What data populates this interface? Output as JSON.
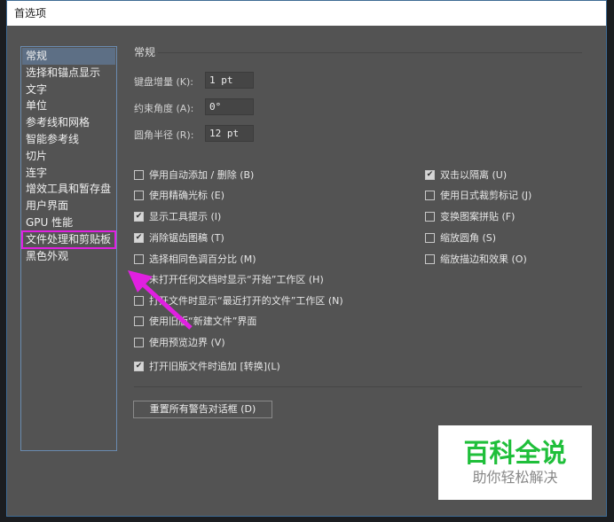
{
  "window": {
    "title": "首选项"
  },
  "sidebar": {
    "items": [
      "常规",
      "选择和锚点显示",
      "文字",
      "单位",
      "参考线和网格",
      "智能参考线",
      "切片",
      "连字",
      "增效工具和暂存盘",
      "用户界面",
      "GPU 性能",
      "文件处理和剪贴板",
      "黑色外观"
    ]
  },
  "main": {
    "heading": "常规",
    "fields": [
      {
        "label": "键盘增量 (K):",
        "value": "1 pt"
      },
      {
        "label": "约束角度 (A):",
        "value": "0°"
      },
      {
        "label": "圆角半径 (R):",
        "value": "12 pt"
      }
    ],
    "left_checks": [
      {
        "label": "停用自动添加 / 删除 (B)",
        "checked": false
      },
      {
        "label": "使用精确光标 (E)",
        "checked": false
      },
      {
        "label": "显示工具提示 (I)",
        "checked": true
      },
      {
        "label": "消除锯齿图稿 (T)",
        "checked": true
      },
      {
        "label": "选择相同色调百分比 (M)",
        "checked": false
      },
      {
        "label": "未打开任何文档时显示“开始”工作区 (H)",
        "checked": true
      },
      {
        "label": "打开文件时显示“最近打开的文件”工作区 (N)",
        "checked": false
      },
      {
        "label": "使用旧版“新建文件”界面",
        "checked": false
      },
      {
        "label": "使用预览边界 (V)",
        "checked": false
      },
      {
        "label": "打开旧版文件时追加 [转换](L)",
        "checked": true
      }
    ],
    "right_checks": [
      {
        "label": "双击以隔离 (U)",
        "checked": true
      },
      {
        "label": "使用日式裁剪标记 (J)",
        "checked": false
      },
      {
        "label": "变换图案拼贴 (F)",
        "checked": false
      },
      {
        "label": "缩放圆角 (S)",
        "checked": false
      },
      {
        "label": "缩放描边和效果 (O)",
        "checked": false
      }
    ],
    "reset_button": "重置所有警告对话框 (D)"
  },
  "watermark": {
    "title": "百科全说",
    "subtitle": "助你轻松解决"
  },
  "colors": {
    "annotation": "#e020e0",
    "watermark_green": "#1fbf3a"
  }
}
